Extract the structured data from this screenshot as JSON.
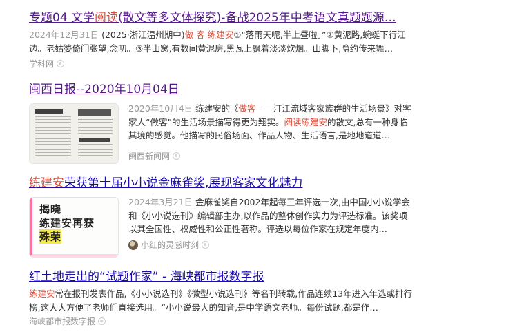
{
  "results": [
    {
      "title": "专题04 文学阅读(散文等多文体探究)-备战2025年中考语文真题题源…",
      "title_pre": "专题04 文学",
      "title_hl": "阅读",
      "title_post": "(散文等多文体探究)-备战2025年中考语文真题题源…",
      "date": "2024年12月31日",
      "snippet_a": " (2025·浙江温州期中)",
      "snippet_hl1": "做 客",
      "snippet_hl2": "练建安",
      "snippet_b": "①“落雨天呢,半上昼啦。”②黄泥路,蜿蜒下行江边。老姑婆倚门张望,念叨。③半山窝,有数间黄泥房,黑瓦上飘着淡淡炊烟。山脚下,隐约传来舞…",
      "source": "学科网"
    },
    {
      "title": "闽西日报--2020年10月04日",
      "date": "2020年10月4日",
      "snippet_a": "  练建安的《",
      "snippet_hl1": "做客",
      "snippet_b": "——汀江流域客家族群的生活场景》对客家人“做客”的生活场景描写得更为翔实。",
      "snippet_hl2": "阅读练建安",
      "snippet_c": "的散文,总有一种身临其境的感觉。他描写的民俗场面、作品人物、生活语言,是地地道道…",
      "source": "闽西新闻网"
    },
    {
      "title_hl": "练建安",
      "title_post": "荣获第十届小小说金麻雀奖,展现客家文化魅力",
      "date": "2024年3月21日",
      "snippet": "  金麻雀奖自2002年起每三年评选一次,由中国小小说学会和《小小说选刊》编辑部主办,以作品的整体创作实力为评选标准。该奖项以其全国性、权威性和公正性著称。评选以每位作家在规定年度内…",
      "source": "小红的灵感时刻",
      "thumb_text": [
        "揭晓",
        "练建安再获",
        "殊荣"
      ]
    },
    {
      "title": "红土地走出的“试题作家” - 海峡都市报数字报",
      "snippet_hl": "练建安",
      "snippet": "常在报刊发表作品,《小小说选刊》《微型小说选刊》等名刊转载,作品连续13年进入年选或排行榜,这大大方便了老师们直接选用。“小小说最大的知音,是中学语文老师。每份试题,都是作…",
      "source": "海峡都市报数字报"
    }
  ],
  "colors": {
    "visited_link": "#551a8b",
    "link": "#1a0dab",
    "highlight": "#dd4b39",
    "date": "#999999"
  }
}
